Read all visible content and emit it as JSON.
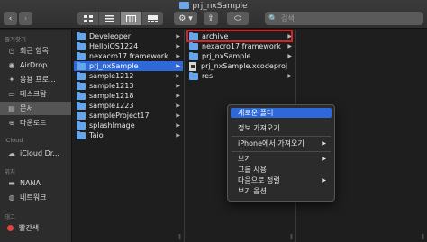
{
  "window": {
    "title": "prj_nxSample"
  },
  "toolbar": {
    "back": "‹",
    "forward": "›",
    "action": "⚙ ▾",
    "share": "⇪",
    "tag": "⬭",
    "search_placeholder": "검색"
  },
  "sidebar": {
    "favorites_header": "즐겨찾기",
    "favorites": [
      {
        "label": "최근 항목",
        "icon": "clock-icon"
      },
      {
        "label": "AirDrop",
        "icon": "airdrop-icon"
      },
      {
        "label": "응용 프로...",
        "icon": "applications-icon"
      },
      {
        "label": "데스크탑",
        "icon": "desktop-icon"
      },
      {
        "label": "문서",
        "icon": "document-icon",
        "selected": true
      },
      {
        "label": "다운로드",
        "icon": "download-icon"
      }
    ],
    "icloud_header": "iCloud",
    "icloud": [
      {
        "label": "iCloud Dr...",
        "icon": "cloud-icon"
      }
    ],
    "locations_header": "위치",
    "locations": [
      {
        "label": "NANA",
        "icon": "computer-icon"
      },
      {
        "label": "네트워크",
        "icon": "network-icon"
      }
    ],
    "tags_header": "태그",
    "tags": [
      {
        "label": "빨간색",
        "color": "#e0443a"
      }
    ]
  },
  "column1": [
    {
      "name": "Develeoper",
      "type": "folder",
      "chevron": true
    },
    {
      "name": "HelloiOS1224",
      "type": "folder",
      "chevron": true
    },
    {
      "name": "nexacro17.framework",
      "type": "folder",
      "chevron": true
    },
    {
      "name": "prj_nxSample",
      "type": "folder",
      "chevron": true,
      "selected": true
    },
    {
      "name": "sample1212",
      "type": "folder",
      "chevron": true
    },
    {
      "name": "sample1213",
      "type": "folder",
      "chevron": true
    },
    {
      "name": "sample1218",
      "type": "folder",
      "chevron": true
    },
    {
      "name": "sample1223",
      "type": "folder",
      "chevron": true
    },
    {
      "name": "sampleProject17",
      "type": "folder",
      "chevron": true
    },
    {
      "name": "splashImage",
      "type": "folder",
      "chevron": true
    },
    {
      "name": "Taio",
      "type": "folder",
      "chevron": true
    }
  ],
  "column2": [
    {
      "name": "archive",
      "type": "folder",
      "chevron": true
    },
    {
      "name": "nexacro17.framework",
      "type": "folder",
      "chevron": true
    },
    {
      "name": "prj_nxSample",
      "type": "folder",
      "chevron": true
    },
    {
      "name": "prj_nxSample.xcodeproj",
      "type": "file",
      "chevron": false
    },
    {
      "name": "res",
      "type": "folder",
      "chevron": true
    }
  ],
  "context_menu": {
    "new_folder": "새로운 폴더",
    "get_info": "정보 가져오기",
    "import_from_iphone": "iPhone에서 가져오기",
    "view": "보기",
    "use_groups": "그룹 사용",
    "sort_by": "다음으로 정렬",
    "view_options": "보기 옵션"
  },
  "colors": {
    "selection": "#2f68d8",
    "highlight_border": "#d62424",
    "folder": "#64a6ec"
  }
}
